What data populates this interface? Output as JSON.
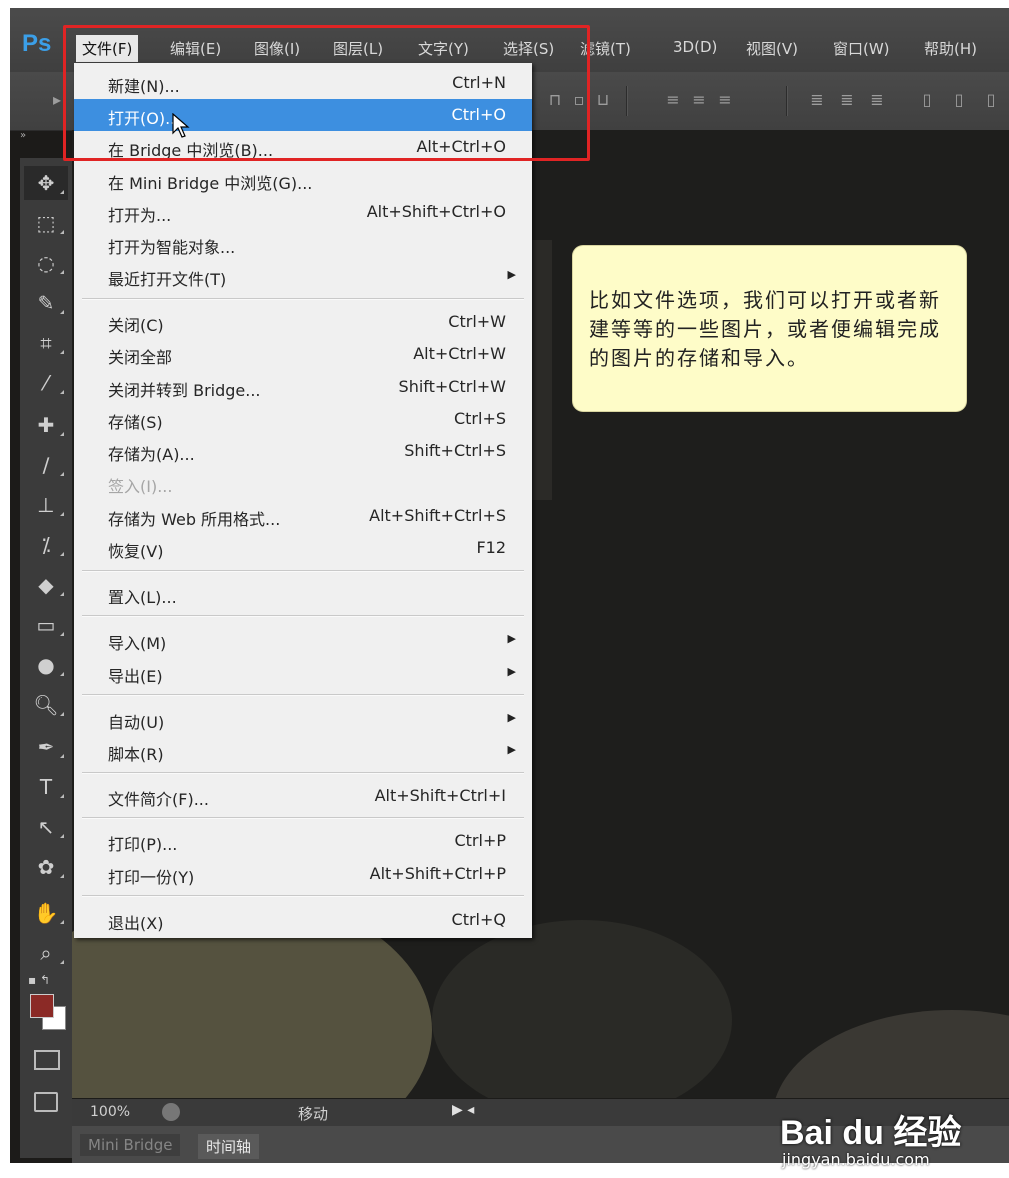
{
  "app": {
    "logo": "Ps"
  },
  "menubar": {
    "items": [
      "文件(F)",
      "编辑(E)",
      "图像(I)",
      "图层(L)",
      "文字(Y)",
      "选择(S)",
      "滤镜(T)",
      "3D(D)",
      "视图(V)",
      "窗口(W)",
      "帮助(H)"
    ],
    "active_index": 0
  },
  "file_menu": {
    "items": [
      {
        "label": "新建(N)...",
        "shortcut": "Ctrl+N"
      },
      {
        "label": "打开(O)...",
        "shortcut": "Ctrl+O",
        "highlighted": true
      },
      {
        "label": "在 Bridge 中浏览(B)...",
        "shortcut": "Alt+Ctrl+O"
      },
      {
        "label": "在 Mini Bridge 中浏览(G)...",
        "shortcut": ""
      },
      {
        "label": "打开为...",
        "shortcut": "Alt+Shift+Ctrl+O"
      },
      {
        "label": "打开为智能对象...",
        "shortcut": ""
      },
      {
        "label": "最近打开文件(T)",
        "shortcut": "",
        "submenu": true
      },
      {
        "label": "关闭(C)",
        "shortcut": "Ctrl+W"
      },
      {
        "label": "关闭全部",
        "shortcut": "Alt+Ctrl+W"
      },
      {
        "label": "关闭并转到 Bridge...",
        "shortcut": "Shift+Ctrl+W"
      },
      {
        "label": "存储(S)",
        "shortcut": "Ctrl+S"
      },
      {
        "label": "存储为(A)...",
        "shortcut": "Shift+Ctrl+S"
      },
      {
        "label": "签入(I)...",
        "shortcut": "",
        "disabled": true
      },
      {
        "label": "存储为 Web 所用格式...",
        "shortcut": "Alt+Shift+Ctrl+S"
      },
      {
        "label": "恢复(V)",
        "shortcut": "F12"
      },
      {
        "label": "置入(L)...",
        "shortcut": ""
      },
      {
        "label": "导入(M)",
        "shortcut": "",
        "submenu": true
      },
      {
        "label": "导出(E)",
        "shortcut": "",
        "submenu": true
      },
      {
        "label": "自动(U)",
        "shortcut": "",
        "submenu": true
      },
      {
        "label": "脚本(R)",
        "shortcut": "",
        "submenu": true
      },
      {
        "label": "文件简介(F)...",
        "shortcut": "Alt+Shift+Ctrl+I"
      },
      {
        "label": "打印(P)...",
        "shortcut": "Ctrl+P"
      },
      {
        "label": "打印一份(Y)",
        "shortcut": "Alt+Shift+Ctrl+P"
      },
      {
        "label": "退出(X)",
        "shortcut": "Ctrl+Q"
      }
    ]
  },
  "callout": {
    "text": "比如文件选项，我们可以打开或者新建等等的一些图片，或者便编辑完成的图片的存储和导入。"
  },
  "status": {
    "zoom": "100%",
    "mode": "移动"
  },
  "bottom_tabs": [
    "Mini Bridge",
    "时间轴"
  ],
  "watermark": {
    "logo": "Bai du 经验",
    "url": "jingyan.baidu.com"
  },
  "colors": {
    "foreground": "#8b2a26",
    "background": "#ffffff",
    "highlight": "#3d8fe0",
    "annotation": "#e02424",
    "callout_bg": "#fefcc8"
  },
  "icons": [
    "move-tool-icon",
    "marquee-tool-icon",
    "lasso-tool-icon",
    "quick-select-icon",
    "crop-tool-icon",
    "eyedropper-icon",
    "healing-brush-icon",
    "brush-tool-icon",
    "clone-stamp-icon",
    "history-brush-icon",
    "eraser-icon",
    "gradient-tool-icon",
    "blur-tool-icon",
    "dodge-tool-icon",
    "pen-tool-icon",
    "type-tool-icon",
    "path-select-icon",
    "shape-tool-icon",
    "hand-tool-icon",
    "zoom-tool-icon"
  ]
}
